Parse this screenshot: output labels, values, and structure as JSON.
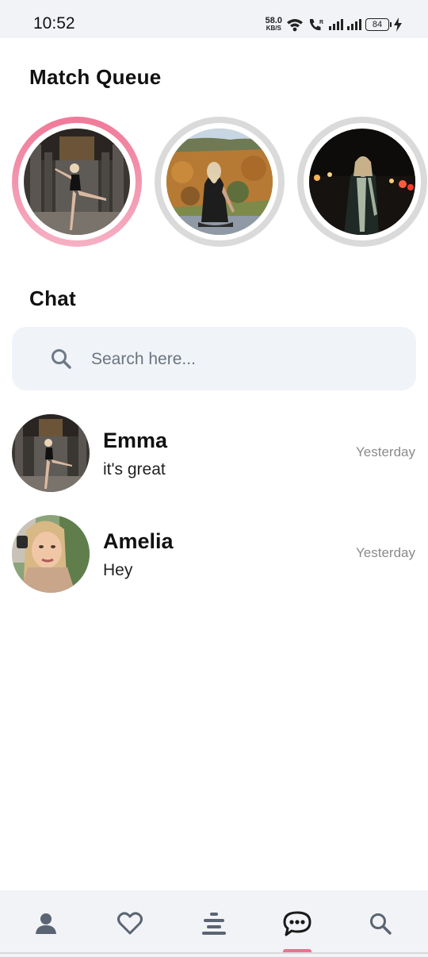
{
  "status": {
    "time": "10:52",
    "net_speed": "58.0",
    "net_unit": "KB/S",
    "battery": "84",
    "icons": [
      "wifi-icon",
      "volte-call-icon",
      "signal-icon",
      "signal-icon",
      "battery-icon",
      "charging-icon"
    ]
  },
  "match_queue": {
    "title": "Match Queue",
    "items": [
      {
        "photo": "dancer-photo",
        "state": "active"
      },
      {
        "photo": "mountain-view-photo",
        "state": "idle"
      },
      {
        "photo": "night-street-photo",
        "state": "idle"
      }
    ]
  },
  "chat": {
    "title": "Chat",
    "search": {
      "placeholder": "Search here..."
    },
    "conversations": [
      {
        "name": "Emma",
        "message": "it's great",
        "time": "Yesterday"
      },
      {
        "name": "Amelia",
        "message": "Hey",
        "time": "Yesterday"
      }
    ]
  },
  "nav": {
    "items": [
      "profile-icon",
      "heart-icon",
      "menu-lines-icon",
      "chat-bubble-icon",
      "search-icon"
    ],
    "active": "chat-bubble-icon",
    "active_color": "#f06f8f"
  },
  "colors": {
    "accent": "#f07a98",
    "surface": "#f1f3f6",
    "search_bg": "#f0f3f8"
  }
}
